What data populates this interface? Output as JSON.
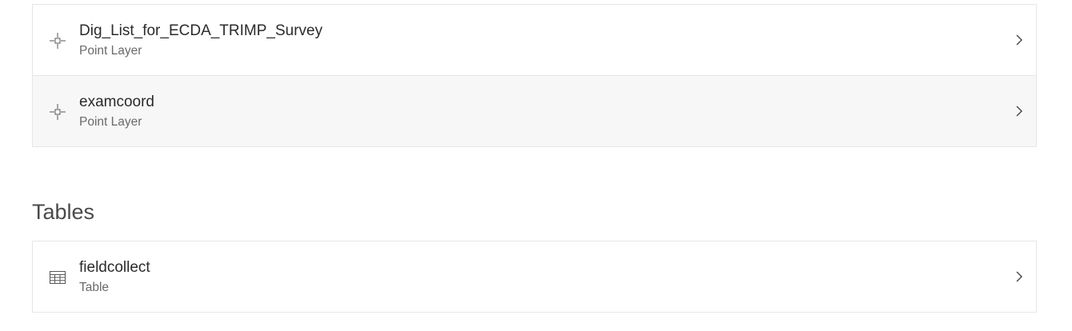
{
  "layers": [
    {
      "title": "Dig_List_for_ECDA_TRIMP_Survey",
      "subtitle": "Point Layer",
      "icon": "point-layer-icon"
    },
    {
      "title": "examcoord",
      "subtitle": "Point Layer",
      "icon": "point-layer-icon"
    }
  ],
  "tables_section": {
    "heading": "Tables",
    "items": [
      {
        "title": "fieldcollect",
        "subtitle": "Table",
        "icon": "table-icon"
      }
    ]
  }
}
